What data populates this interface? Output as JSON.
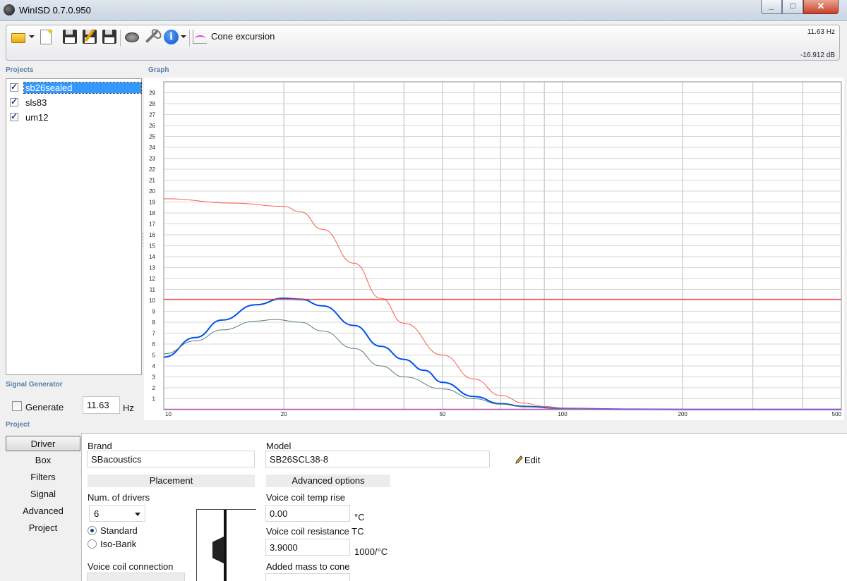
{
  "window": {
    "title": "WinISD 0.7.0.950"
  },
  "toolbar": {
    "graph_type": "Cone excursion",
    "readout_freq": "11.63 Hz",
    "readout_db": "-16.912 dB"
  },
  "sections": {
    "projects": "Projects",
    "graph": "Graph",
    "signal_generator": "Signal Generator",
    "project": "Project"
  },
  "projects": [
    {
      "name": "sb26sealed",
      "checked": true,
      "selected": true
    },
    {
      "name": "sls83",
      "checked": true,
      "selected": false
    },
    {
      "name": "um12",
      "checked": true,
      "selected": false
    }
  ],
  "signal_generator": {
    "generate_label": "Generate",
    "frequency": "11.63",
    "unit": "Hz"
  },
  "nav": [
    "Driver",
    "Box",
    "Filters",
    "Signal",
    "Advanced",
    "Project"
  ],
  "driver": {
    "brand_label": "Brand",
    "brand_value": "SBacoustics",
    "model_label": "Model",
    "model_value": "SB26SCL38-8",
    "edit_label": "Edit",
    "placement_header": "Placement",
    "num_drivers_label": "Num. of drivers",
    "num_drivers_value": "6",
    "radio_standard": "Standard",
    "radio_isobarik": "Iso-Barik",
    "vc_connection_label": "Voice coil connection",
    "advanced_header": "Advanced options",
    "vc_temp_label": "Voice coil temp rise",
    "vc_temp_value": "0.00",
    "vc_temp_unit": "°C",
    "vc_res_tc_label": "Voice coil resistance TC",
    "vc_res_tc_value": "3.9000",
    "vc_res_tc_unit": "1000/°C",
    "added_mass_label": "Added mass to cone"
  },
  "chart_data": {
    "type": "line",
    "x_scale": "log",
    "xlim": [
      10,
      500
    ],
    "ylim": [
      0,
      30
    ],
    "x_tick_labels": [
      10,
      20,
      50,
      100,
      200,
      500
    ],
    "y_tick_labels": [
      1,
      2,
      3,
      4,
      5,
      6,
      7,
      8,
      9,
      10,
      11,
      12,
      13,
      14,
      15,
      16,
      17,
      18,
      19,
      20,
      21,
      22,
      23,
      24,
      25,
      26,
      27,
      28,
      29
    ],
    "grid": true,
    "series": [
      {
        "color": "#ff5a4a",
        "width": 1,
        "x": [
          10,
          15,
          20,
          22,
          25,
          30,
          35,
          40,
          50,
          60,
          70,
          80,
          90,
          100,
          120,
          150,
          200,
          300,
          500
        ],
        "y": [
          19.3,
          18.9,
          18.6,
          18.1,
          16.5,
          13.4,
          10.2,
          7.9,
          5.0,
          2.8,
          1.3,
          0.6,
          0.3,
          0.15,
          0.1,
          0.06,
          0.04,
          0.03,
          0.02
        ]
      },
      {
        "color": "#0050f0",
        "width": 2,
        "x": [
          10,
          12,
          14,
          17,
          20,
          22,
          25,
          30,
          35,
          40,
          45,
          50,
          60,
          70,
          80,
          100,
          150,
          200,
          500
        ],
        "y": [
          4.8,
          6.6,
          8.2,
          9.6,
          10.2,
          10.1,
          9.5,
          7.7,
          5.8,
          4.6,
          3.6,
          2.5,
          1.2,
          0.55,
          0.3,
          0.1,
          0.04,
          0.02,
          0.01
        ]
      },
      {
        "color": "#5a8078",
        "width": 1,
        "x": [
          10,
          12,
          14,
          17,
          19,
          22,
          25,
          30,
          35,
          40,
          50,
          60,
          70,
          80,
          100,
          150,
          200,
          500
        ],
        "y": [
          5.1,
          6.3,
          7.3,
          8.1,
          8.25,
          8.0,
          7.2,
          5.6,
          4.0,
          3.0,
          1.9,
          1.0,
          0.5,
          0.25,
          0.1,
          0.04,
          0.02,
          0.01
        ]
      },
      {
        "color": "#ff2020",
        "width": 1,
        "x": [
          10,
          500
        ],
        "y": [
          10.1,
          10.1
        ]
      },
      {
        "color": "#d040d0",
        "width": 1,
        "x": [
          10,
          500
        ],
        "y": [
          0.05,
          0.05
        ]
      }
    ]
  }
}
